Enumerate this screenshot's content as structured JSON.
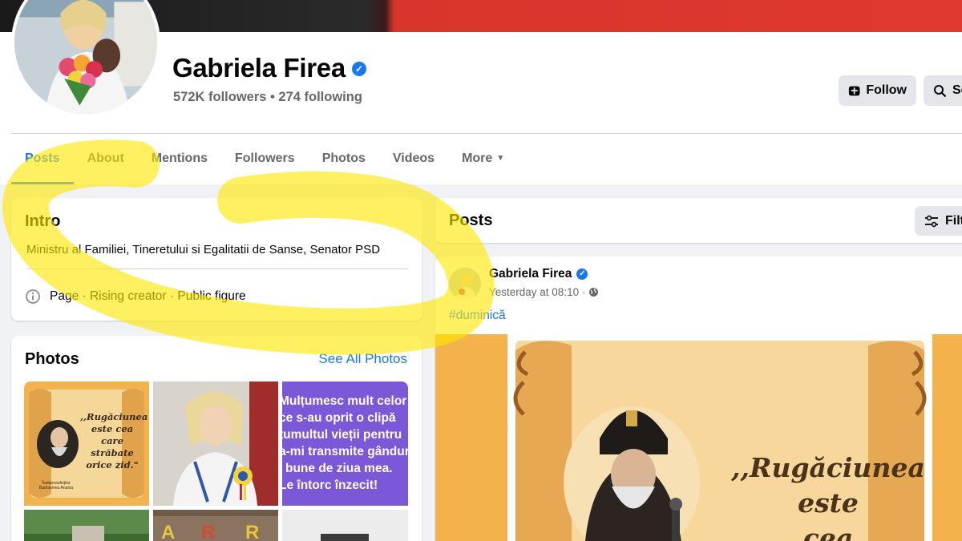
{
  "profile": {
    "name": "Gabriela Firea",
    "verified_mark": "✓",
    "followers_line": "572K followers • 274 following",
    "follow_label": "Follow",
    "search_label": "Se"
  },
  "tabs": [
    {
      "label": "Posts",
      "active": true
    },
    {
      "label": "About"
    },
    {
      "label": "Mentions"
    },
    {
      "label": "Followers"
    },
    {
      "label": "Photos"
    },
    {
      "label": "Videos"
    },
    {
      "label": "More"
    }
  ],
  "intro": {
    "title": "Intro",
    "bio": "Ministru al Familiei, Tineretului si Egalitatii de Sanse, Senator PSD",
    "category": "Page · Rising creator · Public figure"
  },
  "photos": {
    "title": "Photos",
    "see_all": "See All Photos",
    "thumb1_text": ",,Rugăciunea este cea care străbate orice zid.\"",
    "thumb1_caption": "Înaltpreasfințitul Bartolomeu Anania",
    "thumb3_lines": [
      "Mulțumesc mult celor",
      "ce s-au oprit o clipă",
      "tumultul vieții pentru",
      "a-mi transmite gânduri",
      "bune de ziua mea.",
      "Le întorc înzecit!"
    ]
  },
  "posts": {
    "title": "Posts",
    "filter_label": "Filt",
    "post": {
      "author": "Gabriela Firea",
      "time": "Yesterday at 08:10 ·",
      "hashtag": "#duminică",
      "image_text_line1": ",,Rugăciunea",
      "image_text_line2": "este",
      "image_text_line3": "cea"
    }
  },
  "colors": {
    "accent": "#1877f2",
    "highlight": "#ffe600",
    "scroll_bg": "#f3b24c"
  }
}
